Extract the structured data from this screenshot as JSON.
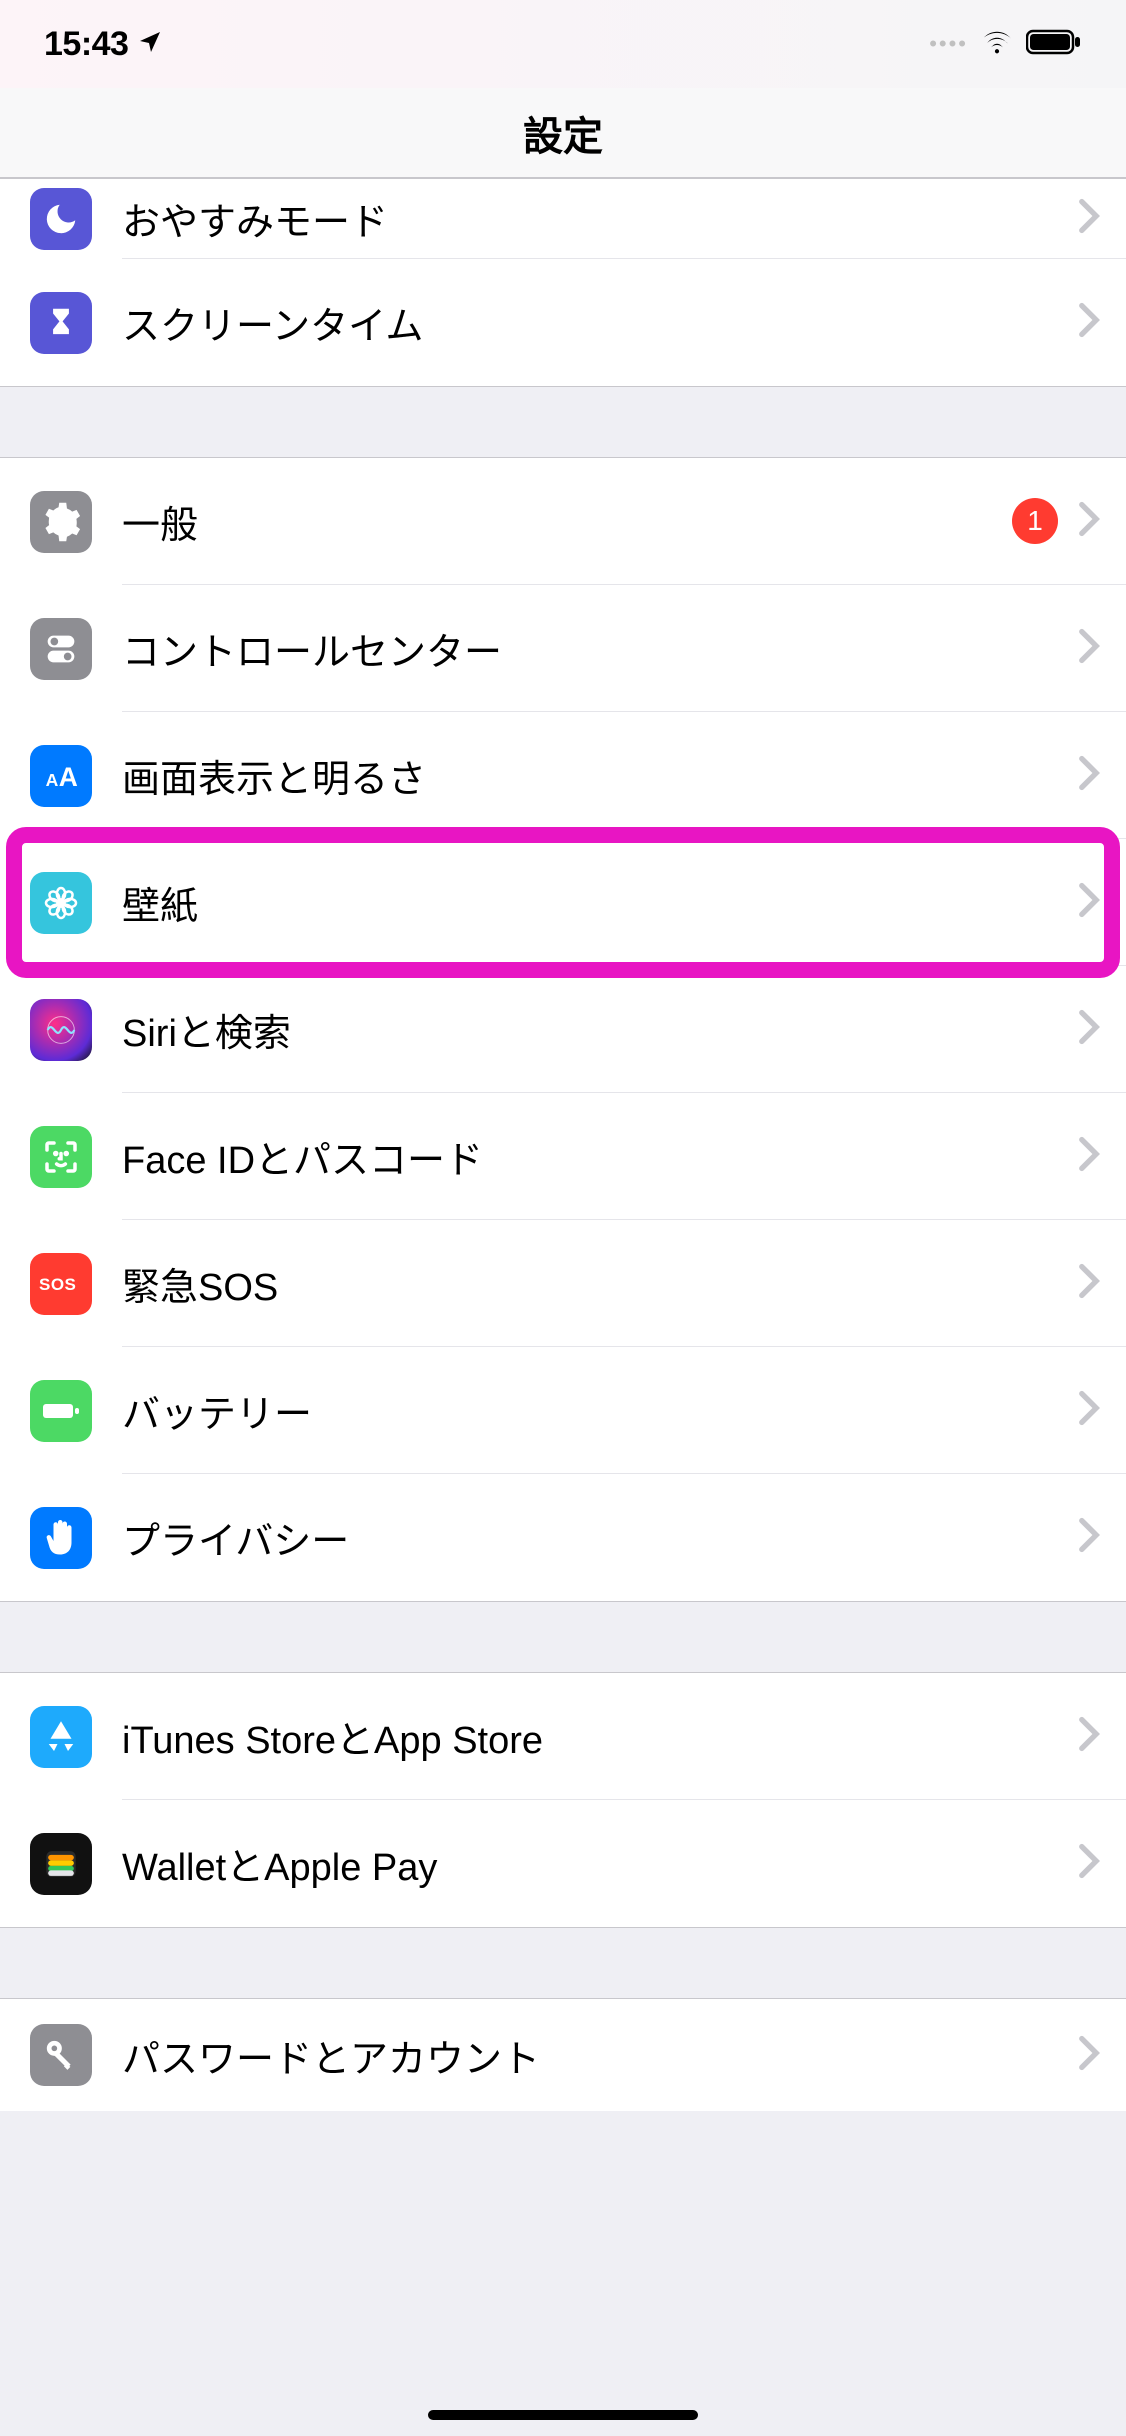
{
  "status": {
    "time": "15:43"
  },
  "header": {
    "title": "設定"
  },
  "groups": [
    {
      "items": [
        {
          "key": "dnd",
          "label": "おやすみモード",
          "partial": "top"
        },
        {
          "key": "screentime",
          "label": "スクリーンタイム"
        }
      ]
    },
    {
      "items": [
        {
          "key": "general",
          "label": "一般",
          "badge": "1"
        },
        {
          "key": "control",
          "label": "コントロールセンター"
        },
        {
          "key": "display",
          "label": "画面表示と明るさ"
        },
        {
          "key": "wallpaper",
          "label": "壁紙",
          "highlighted": true
        },
        {
          "key": "siri",
          "label": "Siriと検索"
        },
        {
          "key": "faceid",
          "label": "Face IDとパスコード"
        },
        {
          "key": "sos",
          "label": "緊急SOS"
        },
        {
          "key": "battery",
          "label": "バッテリー"
        },
        {
          "key": "privacy",
          "label": "プライバシー"
        }
      ]
    },
    {
      "items": [
        {
          "key": "itunes",
          "label": "iTunes StoreとApp Store"
        },
        {
          "key": "wallet",
          "label": "WalletとApple Pay"
        }
      ]
    },
    {
      "items": [
        {
          "key": "passwords",
          "label": "パスワードとアカウント",
          "partial": "bottom"
        }
      ]
    }
  ]
}
